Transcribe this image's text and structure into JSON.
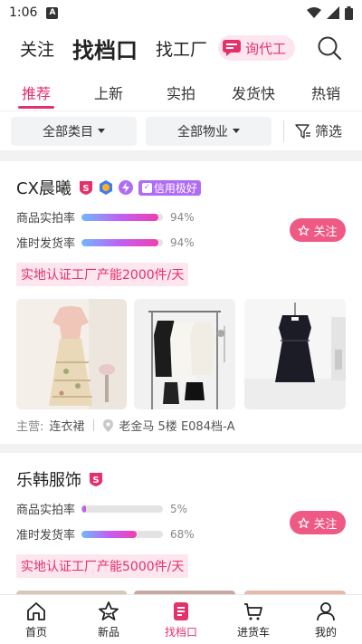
{
  "status": {
    "time": "1:06",
    "notif_icon": "A"
  },
  "top_nav": {
    "tabs": [
      "关注",
      "找档口",
      "找工厂"
    ],
    "inquiry_label": "询代工"
  },
  "sub_tabs": [
    "推荐",
    "上新",
    "实拍",
    "发货快",
    "热销"
  ],
  "filters": {
    "category": "全部类目",
    "property": "全部物业",
    "filter_label": "筛选"
  },
  "colors": {
    "accent": "#e5306a",
    "follow_bg": "#ef5a84",
    "credit_badge": "#b06cf5",
    "tag_bg": "#fde6ee"
  },
  "shops": [
    {
      "name": "CX晨曦",
      "credit": "信用极好",
      "metrics": [
        {
          "label": "商品实拍率",
          "value": "94%",
          "fill": 0.94
        },
        {
          "label": "准时发货率",
          "value": "94%",
          "fill": 0.94
        }
      ],
      "follow_label": "关注",
      "capacity": "实地认证工厂产能2000件/天",
      "main_label": "主营:",
      "main_value": "连衣裙",
      "location": "老金马 5楼 E084档-A"
    },
    {
      "name": "乐韩服饰",
      "metrics": [
        {
          "label": "商品实拍率",
          "value": "5%",
          "fill": 0.05
        },
        {
          "label": "准时发货率",
          "value": "68%",
          "fill": 0.68
        }
      ],
      "follow_label": "关注",
      "capacity": "实地认证工厂产能5000件/天"
    }
  ],
  "bottom_nav": [
    "首页",
    "新品",
    "找档口",
    "进货车",
    "我的"
  ]
}
